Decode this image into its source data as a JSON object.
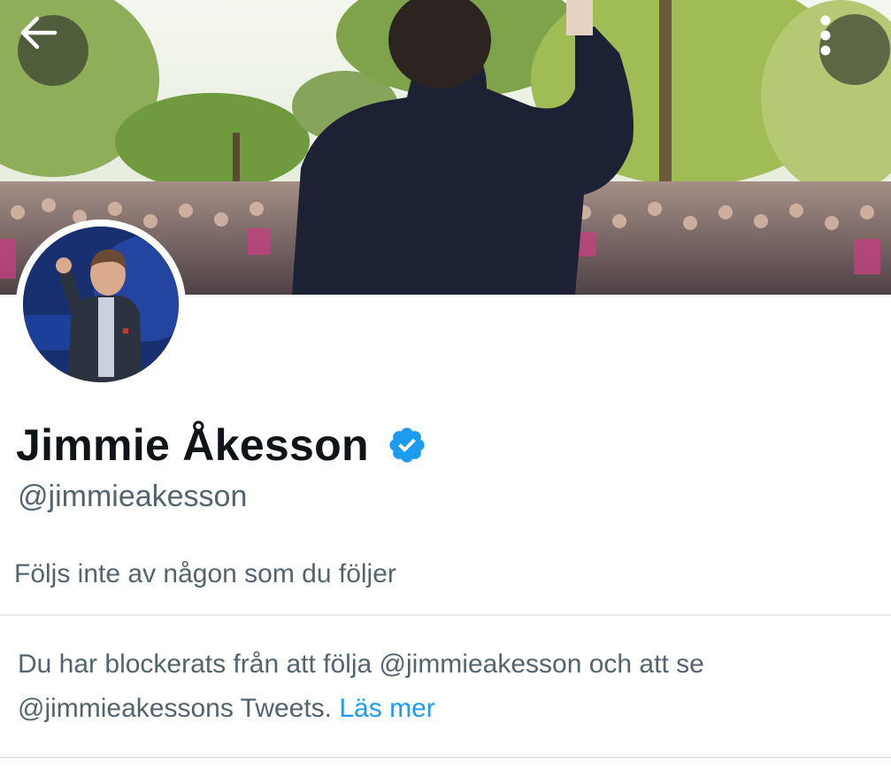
{
  "header": {
    "back_icon": "arrow-left-icon",
    "more_icon": "more-vertical-icon"
  },
  "profile": {
    "display_name": "Jimmie Åkesson",
    "verified_icon": "verified-badge-icon",
    "handle": "@jimmieakesson",
    "followed_by_text": "Följs inte av någon som du följer"
  },
  "blocked_notice": {
    "text": "Du har blockerats från att följa @jimmieakesson och att se @jimmieakessons Tweets.",
    "link_label": "Läs mer"
  },
  "colors": {
    "primary_text": "#0f1419",
    "secondary_text": "#536471",
    "link": "#1d9bf0",
    "verified": "#1d9bf0",
    "divider": "#e6e9eb"
  }
}
